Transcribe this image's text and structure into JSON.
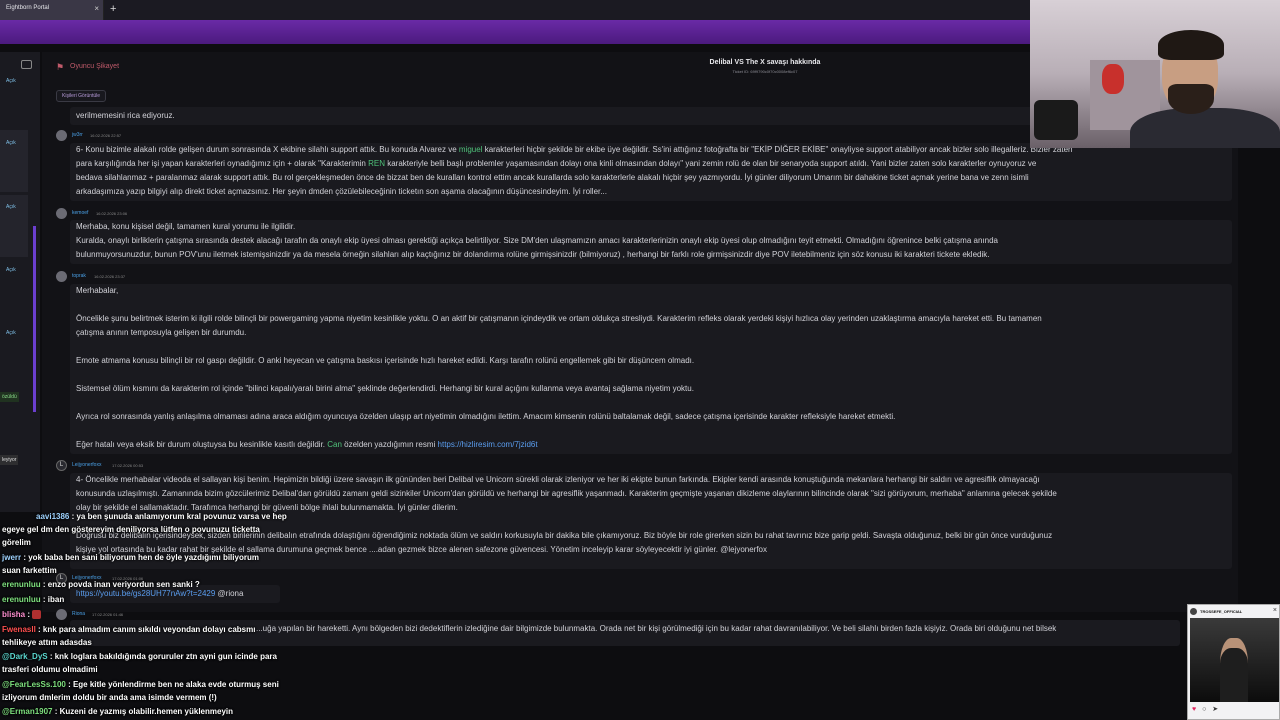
{
  "browser": {
    "tab_title": "Eightborn Portal",
    "tab_close": "×",
    "new_tab": "+"
  },
  "rail": {
    "statuses": [
      "Açık",
      "Açık",
      "Açık",
      "Açık"
    ],
    "status_cozuldu": "özüldü",
    "status_reddedildi": "leyiyor"
  },
  "panel": {
    "category": "Oyuncu Şikayet",
    "title": "Delibal VS The X savaşı hakkında",
    "ticket_id": "Ticket ID: 69f9790c0f70c0008ef6c07",
    "participants_button": "Kişileri Görüntüle"
  },
  "messages": [
    {
      "lines": [
        "verilmemesini rica ediyoruz."
      ]
    },
    {
      "user": "jw3rr",
      "date": "16.02.2026 22:57",
      "lines": [
        [
          "6- Konu bizimle alakalı rolde gelişen durum sonrasında X ekibine silahlı support attık. Bu konuda Alvarez ve ",
          "miguel",
          " karakterleri hiçbir şekilde bir ekibe üye değildir. Ss'ini attığınız fotoğrafta bir \"EKİP DİĞER EKİBE\" onayliyse support atabiliyor ancak bizler solo illegalleriz. Bizler zaten"
        ],
        [
          "para karşılığında her işi yapan karakterleri oynadığımız için + olarak \"Karakterimin ",
          "REN",
          " karakteriyle belli başlı problemler yaşamasından dolayı ona kinli olmasından dolayı\" yani zemin rolü de olan bir senaryoda support atıldı. Yani bizler zaten solo karakterler oynuyoruz ve"
        ],
        [
          "bedava silahlanmaz + paralanmaz alarak support attık. Bu rol gerçekleşmeden önce de bizzat ben de kuralları kontrol ettim ancak kurallarda solo karakterlerle alakalı hiçbir şey yazmıyordu. İyi günler diliyorum Umarım bir dahakine ticket açmak yerine bana ve zenn isimli",
          "",
          ""
        ],
        [
          "arkadaşımıza yazıp bilgiyi alıp direkt ticket açmazsınız. Her şeyin dmden çözülebileceğinin ticketın son aşama olacağının düşüncesindeyim. İyi roller...",
          "",
          ""
        ]
      ]
    },
    {
      "user": "kemoef",
      "date": "16.02.2026 23:06",
      "lines": [
        "Merhaba, konu kişisel değil, tamamen kural yorumu ile ilgilidir.",
        "Kuralda, onaylı birliklerin çatışma sırasında destek alacağı tarafın da onaylı ekip üyesi olması gerektiği açıkça belirtiliyor. Size DM'den ulaşmamızın amacı karakterlerinizin onaylı ekip üyesi olup olmadığını teyit etmekti. Olmadığını öğrenince belki çatışma anında",
        "bulunmuyorsunuzdur, bunun POV'unu iletmek istemişsinizdir ya da mesela örneğin silahları alıp kaçtığınız bir dolandırma rolüne girmişsinizdir (bilmiyoruz) , herhangi bir farklı role girmişsinizdir diye POV iletebilmeniz için söz konusu iki karakteri tickete ekledik."
      ]
    },
    {
      "user": "toprak",
      "date": "16.02.2026 23:37",
      "lines": [
        "Merhabalar,",
        "",
        "Öncelikle şunu belirtmek isterim ki ilgili rolde bilinçli bir powergaming yapma niyetim kesinlikle yoktu. O an aktif bir çatışmanın içindeydik ve ortam oldukça stresliydi. Karakterim refleks olarak yerdeki kişiyi hızlıca olay yerinden uzaklaştırma amacıyla hareket etti. Bu tamamen",
        "çatışma anının temposuyla gelişen bir durumdu.",
        "",
        "Emote atmama konusu bilinçli bir rol gaspı değildir. O anki heyecan ve çatışma baskısı içerisinde hızlı hareket edildi. Karşı tarafın rolünü engellemek gibi bir düşüncem olmadı.",
        "",
        "Sistemsel ölüm kısmını da karakterim rol içinde \"bilinci kapalı/yaralı birini alma\" şeklinde değerlendirdi. Herhangi bir kural açığını kullanma veya avantaj sağlama niyetim yoktu.",
        "",
        "Ayrıca rol sonrasında yanlış anlaşılma olmaması adına araca aldığım oyuncuya özelden ulaşıp art niyetimin olmadığını ilettim. Amacım kimsenin rolünü baltalamak değil, sadece çatışma içerisinde karakter refleksiyle hareket etmekti.",
        ""
      ],
      "last_line": {
        "pre": "Eğer hatalı veya eksik bir durum oluştuysa bu kesinlikle kasıtlı değildir. ",
        "mention": "Can",
        "mid": " özelden yazdığımın resmi ",
        "link": "https://hizliresim.com/7jzid6t"
      }
    },
    {
      "user": "Leijyonerfoxx",
      "date": "17.02.2026 00:53",
      "lines": [
        "4- Öncelikle merhabalar videoda el sallayan kişi benim. Hepimizin bildiği üzere savaşın ilk gününden beri Delibal ve Unicorn sürekli olarak izleniyor ve her iki ekipte bunun farkında. Ekipler kendi arasında konuştuğunda mekanlara herhangi bir saldırı ve agresiflik olmayacağı",
        "konusunda uzlaşılmıştı. Zamanında bizim gözcülerimiz Delibal'dan görüldü zamanı geldi sizinkiler Unicorn'dan görüldü ve herhangi bir agresiflik yaşanmadı. Karakterim geçmişte yaşanan dikizleme olaylarının bilincinde olarak \"sizi görüyorum, merhaba\" anlamına gelecek şekilde",
        "olay bir şekilde el sallamaktadır. Tarafımca herhangi bir güvenli bölge ihlali bulunmamakta. İyi günler dilerim.",
        "",
        "Doğrusu biz delibalın içerisindeysek, sizden birilerinin delibalın etrafında dolaştığını öğrendiğimiz noktada ölüm ve saldırı korkusuyla bir dakika bile çıkamıyoruz. Biz böyle bir role girerken sizin bu rahat tavrınız bize garip geldi. Savaşta olduğunuz, belki bir gün önce vurduğunuz",
        "kişiye yol ortasında bu kadar rahat bir şekilde el sallama durumuna geçmek bence ....adan gezmek bizce alenen safezone güvencesi. Yönetim inceleyip karar söyleyecektir iyi günler. @lejyonerfox"
      ]
    },
    {
      "user": "Leijyonerfoxx",
      "date": "17.02.2026 01:06",
      "link": "https://youtu.be/gs28UH77nAw?t=2429",
      "mention": "@riona"
    },
    {
      "user": "Riona",
      "date": "17.02.2026 01:46",
      "line": "...uğa yapılan bir hareketti. Aynı bölgeden bizi dedektiflerin izlediğine dair bilgimizde bulunmakta. Orada net bir kişi görülmediği için bu kadar rahat davranılabiliyor. Ve beli silahlı birden fazla kişiyiz. Orada biri olduğunu net bilsek"
    }
  ],
  "chat": [
    {
      "user": "aavi1386",
      "text": " : ya ben şunuda anlamıyorum kral povunuz varsa ve hep",
      "color": "default"
    },
    {
      "user": "",
      "text": "egeye gel dm den göstereyim deniliyorsa lütfen o povunuzu ticketta",
      "color": "default"
    },
    {
      "user": "",
      "text": "görelim",
      "color": "default"
    },
    {
      "user": "jwerr",
      "text": " : yok baba ben sani biliyorum hen de öyle yazdığımı biliyorum",
      "color": "default"
    },
    {
      "user": "",
      "text": "suan farkettim",
      "color": "default"
    },
    {
      "user": "erenunluu",
      "text": " : enzo povda inan veriyordun sen sanki ?",
      "color": "green"
    },
    {
      "user": "erenunluu",
      "text": " : iban",
      "color": "green"
    },
    {
      "user": "blisha",
      "text": " : ",
      "color": "pink"
    },
    {
      "user": "Fwenasll",
      "text": " : knk para almadım canım sıkıldı veyondan dolayı cabsmı",
      "color": "red"
    },
    {
      "user": "",
      "text": "tehlikeye attım adasdas",
      "color": "default"
    },
    {
      "user": "",
      "text": " : knk loglara bakıldığında goruruler ztn ayni gun icinde para",
      "color": "default"
    },
    {
      "user": "",
      "text": "trasferi oldumu olmadimi",
      "color": "default"
    },
    {
      "user": "@Dark_DyS",
      "text": " : knk loglara bakıldığında goruruler ztn ayni gun icinde para",
      "color": "teal"
    },
    {
      "user": "@FearLesSs.100",
      "text": " : Ege kitle yönlendirme ben ne alaka evde oturmuş seni",
      "color": "green"
    },
    {
      "user": "",
      "text": "izliyorum dmlerim doldu bir anda ama isimde vermem (!)",
      "color": "default"
    },
    {
      "user": "@Erman1907",
      "text": " : Kuzeni de yazmış olabilir.hemen yüklenmeyin",
      "color": "green"
    }
  ],
  "popup": {
    "name": "TROSSEFE_OFFICIAL",
    "close": "×",
    "icons": "♥ ○ ➤"
  },
  "colors": {
    "accent_purple": "#6a2aa6",
    "highlight_green": "#4fc27a",
    "link_blue": "#5b9ef0",
    "category_red": "#c05a6a"
  }
}
